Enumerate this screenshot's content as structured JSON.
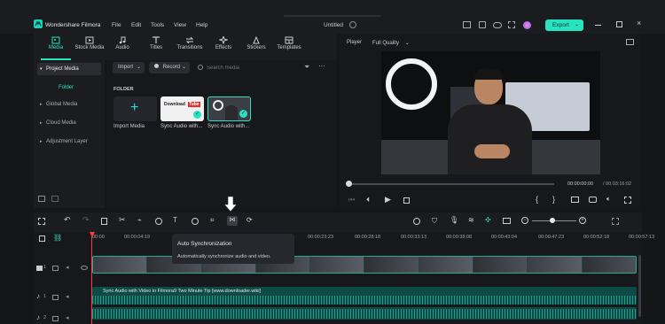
{
  "app": {
    "name": "Wondershare Filmora",
    "menu": [
      "File",
      "Edit",
      "Tools",
      "View",
      "Help"
    ],
    "project_title": "Untitled",
    "export_label": "Export"
  },
  "toolbar": {
    "tabs": [
      "Media",
      "Stock Media",
      "Audio",
      "Titles",
      "Transitions",
      "Effects",
      "Stickers",
      "Templates"
    ]
  },
  "left_nav": {
    "project_media": "Project Media",
    "folder": "Folder",
    "global_media": "Global Media",
    "cloud_media": "Cloud Media",
    "adjustment_layer": "Adjustment Layer"
  },
  "media": {
    "import_label": "Import",
    "record_label": "Record",
    "search_placeholder": "Search media",
    "folder_heading": "FOLDER",
    "items": [
      {
        "label": "Import Media"
      },
      {
        "label": "Sync Audio with..."
      },
      {
        "label": "Sync Audio with..."
      }
    ],
    "thumb_text_a": "Download",
    "thumb_text_b": "Tube"
  },
  "player": {
    "label": "Player",
    "quality": "Full Quality",
    "time_current": "00:00:00:00",
    "time_total": "/ 00:03:16:02"
  },
  "timeline": {
    "timestamps": [
      "00:00",
      "00:00:04:19",
      "00:00:23:23",
      "00:00:28:18",
      "00:00:33:13",
      "00:00:38:08",
      "00:00:43:04",
      "00:00:47:23",
      "00:00:52:18",
      "00:00:57:13"
    ],
    "tooltip_title": "Auto Synchronization",
    "tooltip_desc": "Automatically synchronize audio and video.",
    "audio_clip_label": "Sync Audio with Video in Filmora9 Two Minute Tip [www.downloader.wiki]",
    "track_numbers": [
      "1",
      "1",
      "2"
    ]
  },
  "colors": {
    "accent": "#28e3c0",
    "video_clip": "#1c4a46",
    "audio_clip": "#0e4b47",
    "playhead": "#ff3b3b"
  }
}
